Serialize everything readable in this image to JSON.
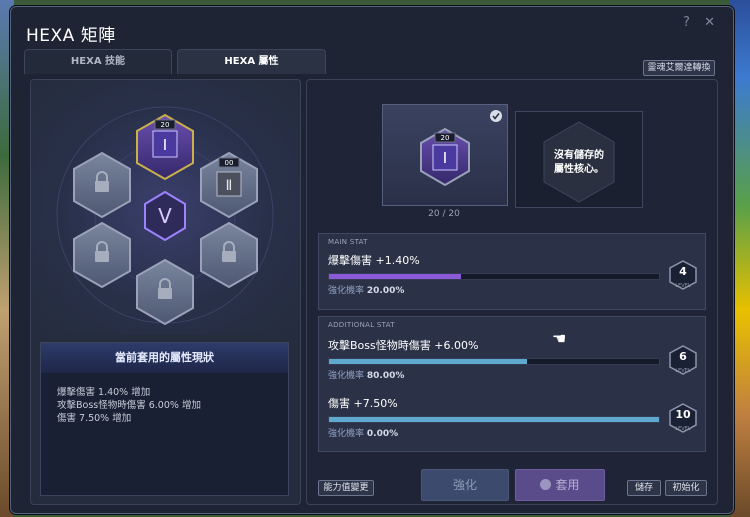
{
  "window": {
    "title": "HEXA 矩陣",
    "help": "?",
    "close": "✕"
  },
  "tabs": [
    {
      "label": "HEXA 技能",
      "active": false
    },
    {
      "label": "HEXA 屬性",
      "active": true
    }
  ],
  "soul_button": "靈魂艾爾達轉換",
  "matrix": {
    "nodes": [
      {
        "type": "stat",
        "level": "20",
        "glyph": "Ⅰ",
        "state": "active"
      },
      {
        "type": "stat",
        "level": "00",
        "glyph": "Ⅱ",
        "state": "unlocked"
      },
      {
        "type": "locked"
      },
      {
        "type": "locked"
      },
      {
        "type": "locked"
      },
      {
        "type": "locked"
      }
    ]
  },
  "summary": {
    "header": "當前套用的屬性現狀",
    "lines": [
      "爆擊傷害 1.40% 增加",
      "攻擊Boss怪物時傷害 6.00% 增加",
      "傷害 7.50% 增加"
    ]
  },
  "core_card": {
    "level": "20",
    "glyph": "Ⅰ",
    "counter": "20 / 20"
  },
  "empty_card": {
    "text1": "沒有儲存的",
    "text2": "屬性核心。"
  },
  "main_stat": {
    "header": "MAIN STAT",
    "stats": [
      {
        "name": "爆擊傷害 +1.40%",
        "rate_label": "強化機率",
        "rate": "20.00%",
        "level": "4",
        "level_tag": "LEVEL",
        "progress": 0.4,
        "color": "#8a5ad8"
      }
    ]
  },
  "additional_stat": {
    "header": "ADDITIONAL STAT",
    "stats": [
      {
        "name": "攻擊Boss怪物時傷害 +6.00%",
        "rate_label": "強化機率",
        "rate": "80.00%",
        "level": "6",
        "level_tag": "LEVEL",
        "progress": 0.6,
        "color": "#5fa8d0"
      },
      {
        "name": "傷害 +7.50%",
        "rate_label": "強化機率",
        "rate": "0.00%",
        "level": "10",
        "level_tag": "LEVEL",
        "progress": 1.0,
        "color": "#5fa8d0"
      }
    ]
  },
  "buttons": {
    "ability_change": "能力值變更",
    "enhance": "強化",
    "apply": "套用",
    "save": "儲存",
    "reset": "初始化"
  },
  "colors": {
    "accent_purple": "#8a5ad8",
    "accent_blue": "#5fa8d0",
    "panel": "#1f2536"
  }
}
